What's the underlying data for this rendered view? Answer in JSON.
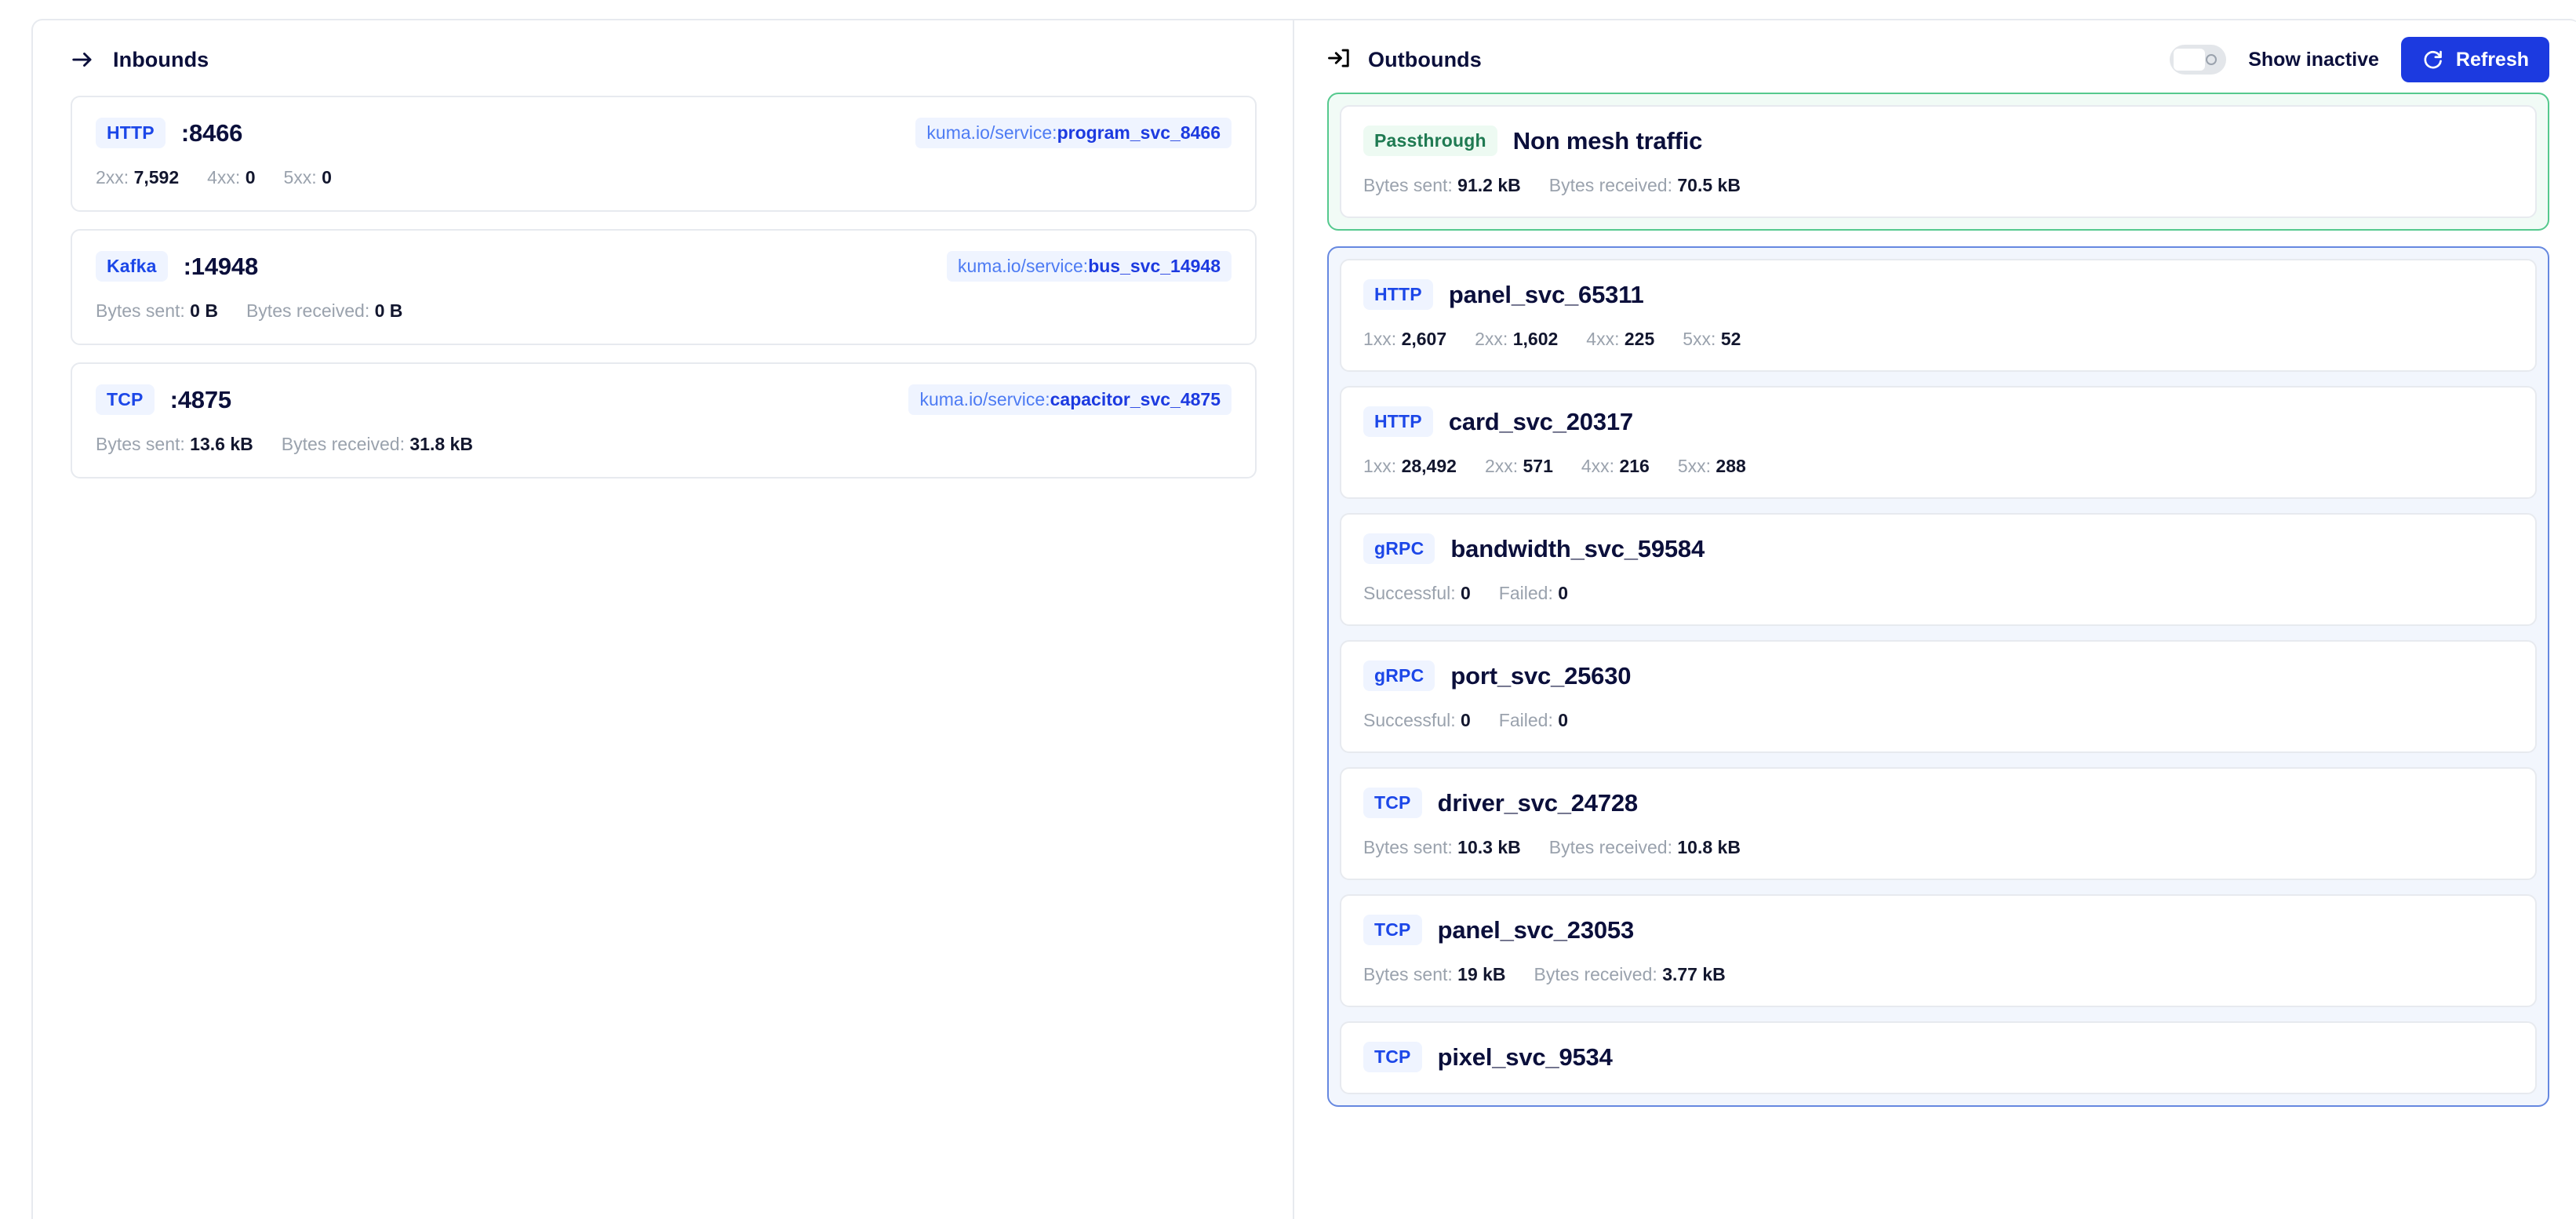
{
  "inbounds": {
    "icon": "arrow-right-icon",
    "title": "Inbounds",
    "items": [
      {
        "protocol": "HTTP",
        "name": ":8466",
        "tag_prefix": "kuma.io/service:",
        "tag_value": "program_svc_8466",
        "stats": [
          {
            "label": "2xx:",
            "value": "7,592"
          },
          {
            "label": "4xx:",
            "value": "0"
          },
          {
            "label": "5xx:",
            "value": "0"
          }
        ]
      },
      {
        "protocol": "Kafka",
        "name": ":14948",
        "tag_prefix": "kuma.io/service:",
        "tag_value": "bus_svc_14948",
        "stats": [
          {
            "label": "Bytes sent:",
            "value": "0 B"
          },
          {
            "label": "Bytes received:",
            "value": "0 B"
          }
        ]
      },
      {
        "protocol": "TCP",
        "name": ":4875",
        "tag_prefix": "kuma.io/service:",
        "tag_value": "capacitor_svc_4875",
        "stats": [
          {
            "label": "Bytes sent:",
            "value": "13.6 kB"
          },
          {
            "label": "Bytes received:",
            "value": "31.8 kB"
          }
        ]
      }
    ]
  },
  "outbounds": {
    "icon": "arrow-into-bracket-icon",
    "title": "Outbounds",
    "toggle": {
      "label": "Show inactive",
      "state": "off"
    },
    "refresh": {
      "label": "Refresh",
      "icon": "refresh-icon",
      "color": "#1c3ae0"
    },
    "groups": [
      {
        "kind": "passthrough",
        "accent": "#55c98e",
        "items": [
          {
            "protocol": "Passthrough",
            "badge_style": "green",
            "name": "Non mesh traffic",
            "stats": [
              {
                "label": "Bytes sent:",
                "value": "91.2 kB"
              },
              {
                "label": "Bytes received:",
                "value": "70.5 kB"
              }
            ]
          }
        ]
      },
      {
        "kind": "mesh",
        "accent": "#6688e0",
        "items": [
          {
            "protocol": "HTTP",
            "badge_style": "blue",
            "name": "panel_svc_65311",
            "stats": [
              {
                "label": "1xx:",
                "value": "2,607"
              },
              {
                "label": "2xx:",
                "value": "1,602"
              },
              {
                "label": "4xx:",
                "value": "225"
              },
              {
                "label": "5xx:",
                "value": "52"
              }
            ]
          },
          {
            "protocol": "HTTP",
            "badge_style": "blue",
            "name": "card_svc_20317",
            "stats": [
              {
                "label": "1xx:",
                "value": "28,492"
              },
              {
                "label": "2xx:",
                "value": "571"
              },
              {
                "label": "4xx:",
                "value": "216"
              },
              {
                "label": "5xx:",
                "value": "288"
              }
            ]
          },
          {
            "protocol": "gRPC",
            "badge_style": "blue",
            "name": "bandwidth_svc_59584",
            "stats": [
              {
                "label": "Successful:",
                "value": "0"
              },
              {
                "label": "Failed:",
                "value": "0"
              }
            ]
          },
          {
            "protocol": "gRPC",
            "badge_style": "blue",
            "name": "port_svc_25630",
            "stats": [
              {
                "label": "Successful:",
                "value": "0"
              },
              {
                "label": "Failed:",
                "value": "0"
              }
            ]
          },
          {
            "protocol": "TCP",
            "badge_style": "blue",
            "name": "driver_svc_24728",
            "stats": [
              {
                "label": "Bytes sent:",
                "value": "10.3 kB"
              },
              {
                "label": "Bytes received:",
                "value": "10.8 kB"
              }
            ]
          },
          {
            "protocol": "TCP",
            "badge_style": "blue",
            "name": "panel_svc_23053",
            "stats": [
              {
                "label": "Bytes sent:",
                "value": "19 kB"
              },
              {
                "label": "Bytes received:",
                "value": "3.77 kB"
              }
            ]
          },
          {
            "protocol": "TCP",
            "badge_style": "blue",
            "name": "pixel_svc_9534",
            "stats": []
          }
        ]
      }
    ]
  }
}
